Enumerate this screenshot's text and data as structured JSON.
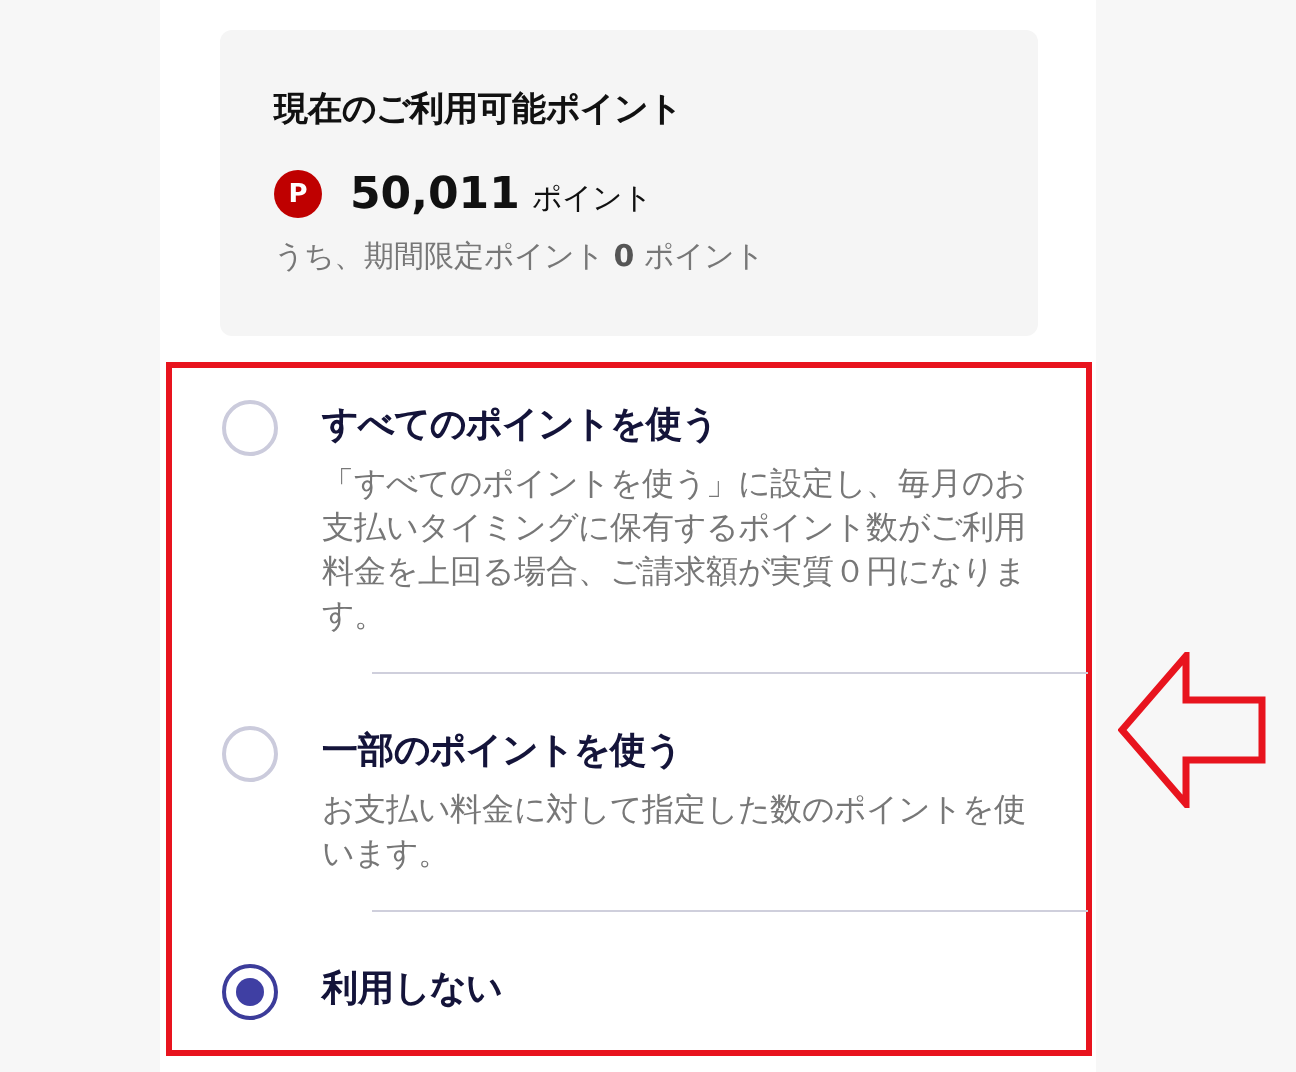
{
  "points_card": {
    "title": "現在のご利用可能ポイント",
    "icon_letter": "P",
    "amount": "50,011",
    "unit": "ポイント",
    "note": "うち、期間限定ポイント **0** ポイント"
  },
  "options": [
    {
      "title": "すべてのポイントを使う",
      "description": "「すべてのポイントを使う」に設定し、毎月のお支払いタイミングに保有するポイント数がご利用料金を上回る場合、ご請求額が実質０円になります。",
      "selected": false
    },
    {
      "title": "一部のポイントを使う",
      "description": "お支払い料金に対して指定した数のポイントを使います。",
      "selected": false
    },
    {
      "title": "利用しない",
      "selected": true
    }
  ]
}
